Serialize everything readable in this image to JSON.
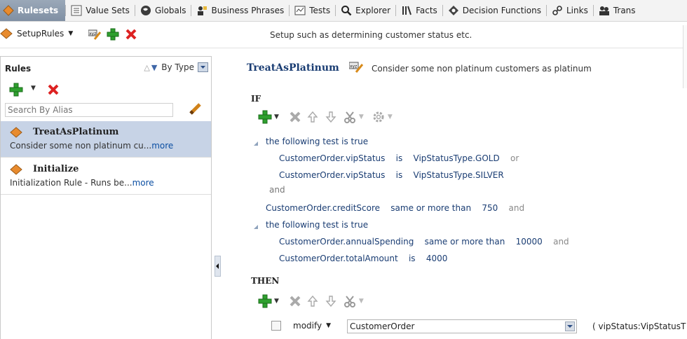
{
  "tabs": [
    {
      "label": "Rulesets",
      "icon": "ruleset-diamond-icon",
      "active": true
    },
    {
      "label": "Value Sets",
      "icon": "value-sets-icon"
    },
    {
      "label": "Globals",
      "icon": "globe-icon"
    },
    {
      "label": "Business Phrases",
      "icon": "business-phrases-icon"
    },
    {
      "label": "Tests",
      "icon": "tests-icon"
    },
    {
      "label": "Explorer",
      "icon": "search-icon"
    },
    {
      "label": "Facts",
      "icon": "facts-icon"
    },
    {
      "label": "Decision Functions",
      "icon": "decision-functions-icon"
    },
    {
      "label": "Links",
      "icon": "link-icon"
    },
    {
      "label": "Trans",
      "icon": "translations-icon"
    }
  ],
  "ruleset": {
    "name": "SetupRules",
    "description": "Setup such as determining customer status etc."
  },
  "left_panel": {
    "title": "Rules",
    "sort_label": "By Type",
    "search_placeholder": "Search By Alias",
    "rules": [
      {
        "name": "TreatAsPlatinum",
        "desc": "Consider some non platinum cu...",
        "more": "more",
        "selected": true
      },
      {
        "name": "Initialize",
        "desc": "Initialization Rule - Runs be...",
        "more": "more",
        "selected": false
      }
    ]
  },
  "rule": {
    "name": "TreatAsPlatinum",
    "description": "Consider some non platinum customers as platinum",
    "if_label": "IF",
    "then_label": "THEN",
    "conditions": {
      "group1_title": "the following test is true",
      "c1": {
        "lhs": "CustomerOrder.vipStatus",
        "op": "is",
        "rhs": "VipStatusType.GOLD",
        "conj": "or"
      },
      "c2": {
        "lhs": "CustomerOrder.vipStatus",
        "op": "is",
        "rhs": "VipStatusType.SILVER"
      },
      "group1_conj": "and",
      "c3": {
        "lhs": "CustomerOrder.creditScore",
        "op": "same or more than",
        "rhs": "750",
        "conj": "and"
      },
      "group2_title": "the following test is true",
      "c4": {
        "lhs": "CustomerOrder.annualSpending",
        "op": "same or more than",
        "rhs": "10000",
        "conj": "and"
      },
      "c5": {
        "lhs": "CustomerOrder.totalAmount",
        "op": "is",
        "rhs": "4000"
      }
    },
    "action": {
      "verb": "modify",
      "target": "CustomerOrder",
      "assignment": "( vipStatus:VipStatusT"
    }
  }
}
